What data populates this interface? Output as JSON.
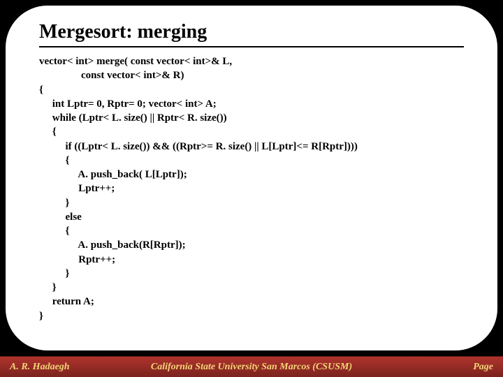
{
  "title": "Mergesort: merging",
  "code": "vector< int> merge( const vector< int>& L,\n                const vector< int>& R)\n{\n     int Lptr= 0, Rptr= 0; vector< int> A;\n     while (Lptr< L. size() || Rptr< R. size())\n     {\n          if ((Lptr< L. size()) && ((Rptr>= R. size() || L[Lptr]<= R[Rptr])))\n          {\n               A. push_back( L[Lptr]);\n               Lptr++;\n          }\n          else\n          {\n               A. push_back(R[Rptr]);\n               Rptr++;\n          }\n     }\n     return A;\n}",
  "footer": {
    "left": "A. R. Hadaegh",
    "center": "California State University San Marcos (CSUSM)",
    "right": "Page"
  }
}
